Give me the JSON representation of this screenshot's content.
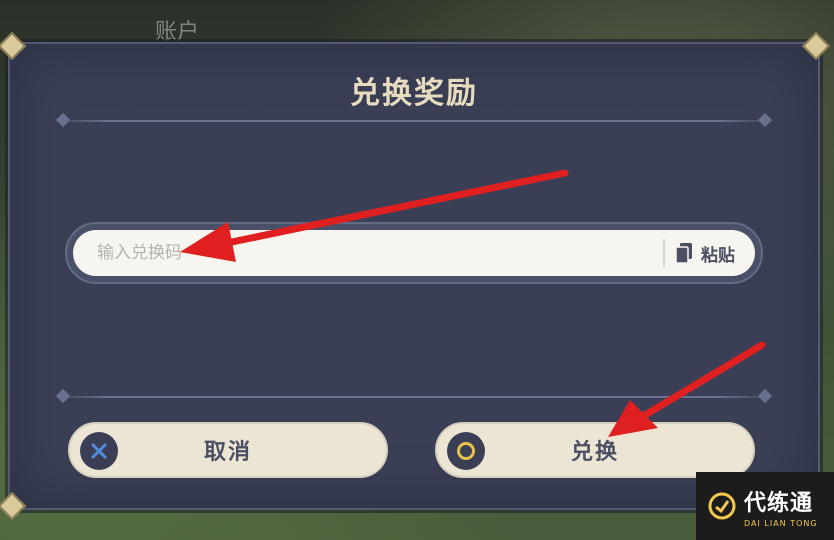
{
  "background": {
    "account_label": "账户"
  },
  "dialog": {
    "title": "兑换奖励",
    "input": {
      "placeholder": "输入兑换码",
      "value": ""
    },
    "paste_label": "粘贴",
    "cancel_label": "取消",
    "confirm_label": "兑换"
  },
  "watermark": {
    "main": "代练通",
    "sub": "DAI LIAN TONG"
  },
  "colors": {
    "dialog_bg": "#3a3f56",
    "title": "#e8dcc0",
    "button_bg": "#ece5d4",
    "annotation_arrow": "#e02020",
    "cancel_icon": "#4f8fe0",
    "confirm_icon": "#e8c24a"
  },
  "icons": {
    "cancel": "close-x-icon",
    "confirm": "circle-icon",
    "paste": "document-icon"
  }
}
